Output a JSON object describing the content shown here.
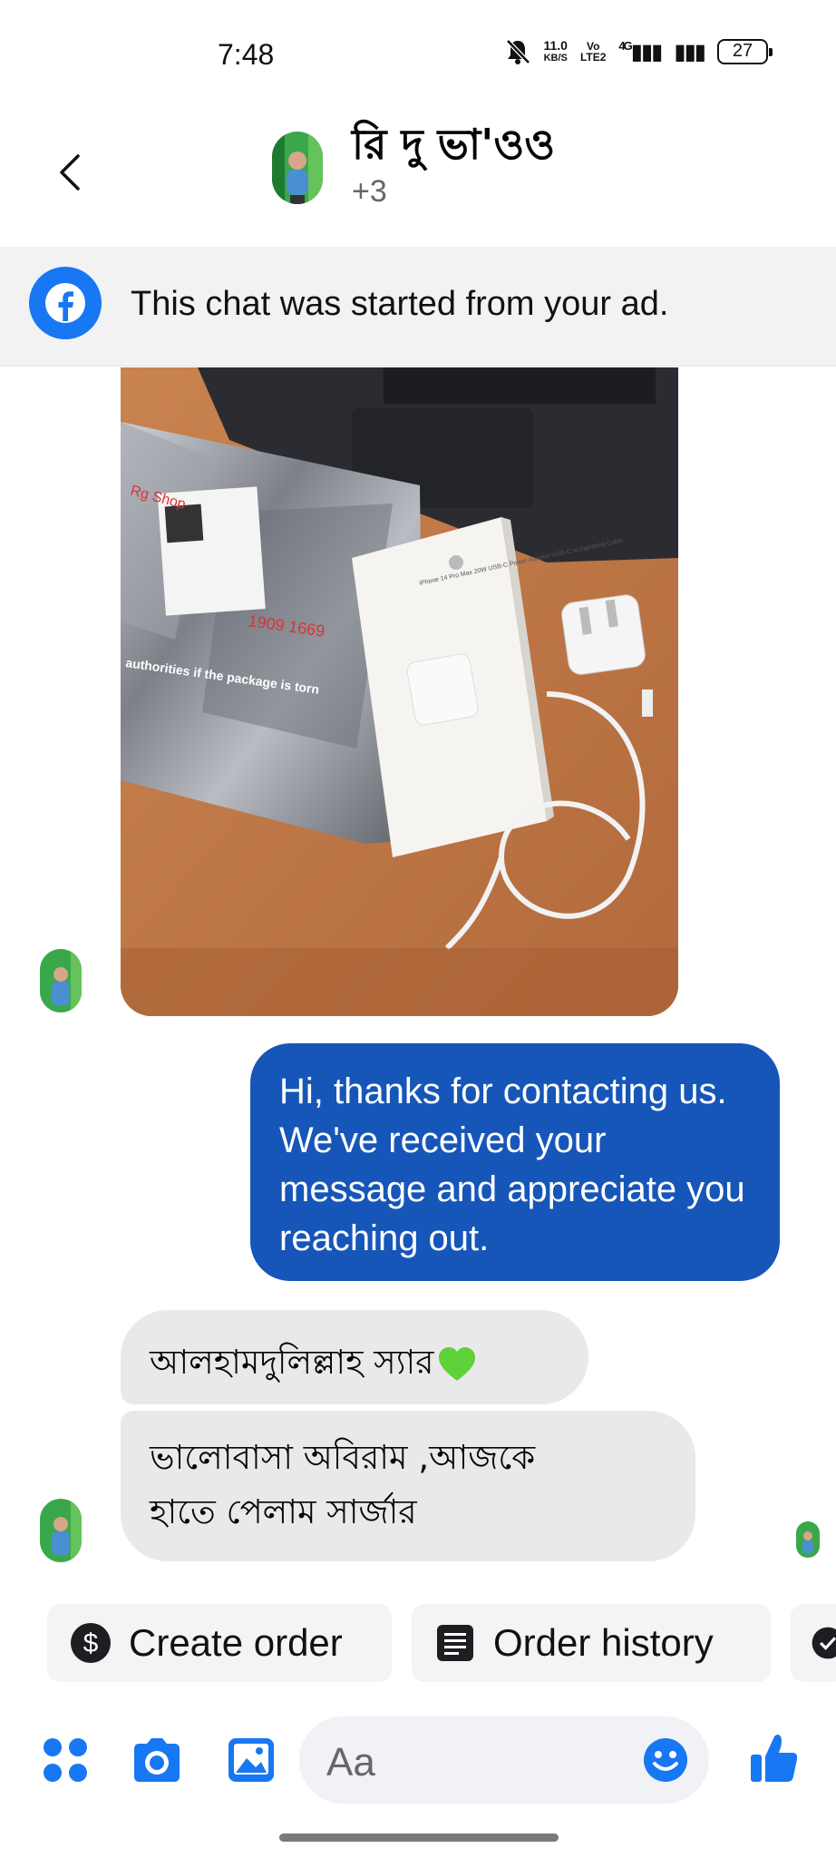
{
  "status_bar": {
    "time": "7:48",
    "net_speed_value": "11.0",
    "net_speed_unit": "KB/S",
    "volte_top": "Vo",
    "volte_bottom": "LTE2",
    "network": "4G",
    "battery": "27"
  },
  "header": {
    "contact_name": "রি দু ভা'ওও",
    "subtitle": "+3"
  },
  "ad_banner": {
    "text": "This chat was started from your ad."
  },
  "photo": {
    "box_label": "iPhone 14 Pro Max 20W USB-C Power Adapter USB-C to Lightning Cable",
    "package_text": "authorities if the package is torn",
    "handwriting": "1909 1669",
    "shop_mark": "Rg Shop"
  },
  "messages": {
    "outgoing": "Hi, thanks for contacting us. We've received your message and appreciate you reaching out.",
    "incoming_1": "আলহামদুলিল্লাহ স্যার",
    "incoming_2_line1": "ভালোবাসা অবিরাম ,আজকে",
    "incoming_2_line2": "হাতে পেলাম সার্জার"
  },
  "quick_actions": {
    "create_order": "Create order",
    "order_history": "Order history"
  },
  "composer": {
    "placeholder": "Aa"
  },
  "colors": {
    "accent": "#1877f2",
    "outgoing_bubble": "#1656b8",
    "incoming_bubble": "#e9e9eb"
  }
}
